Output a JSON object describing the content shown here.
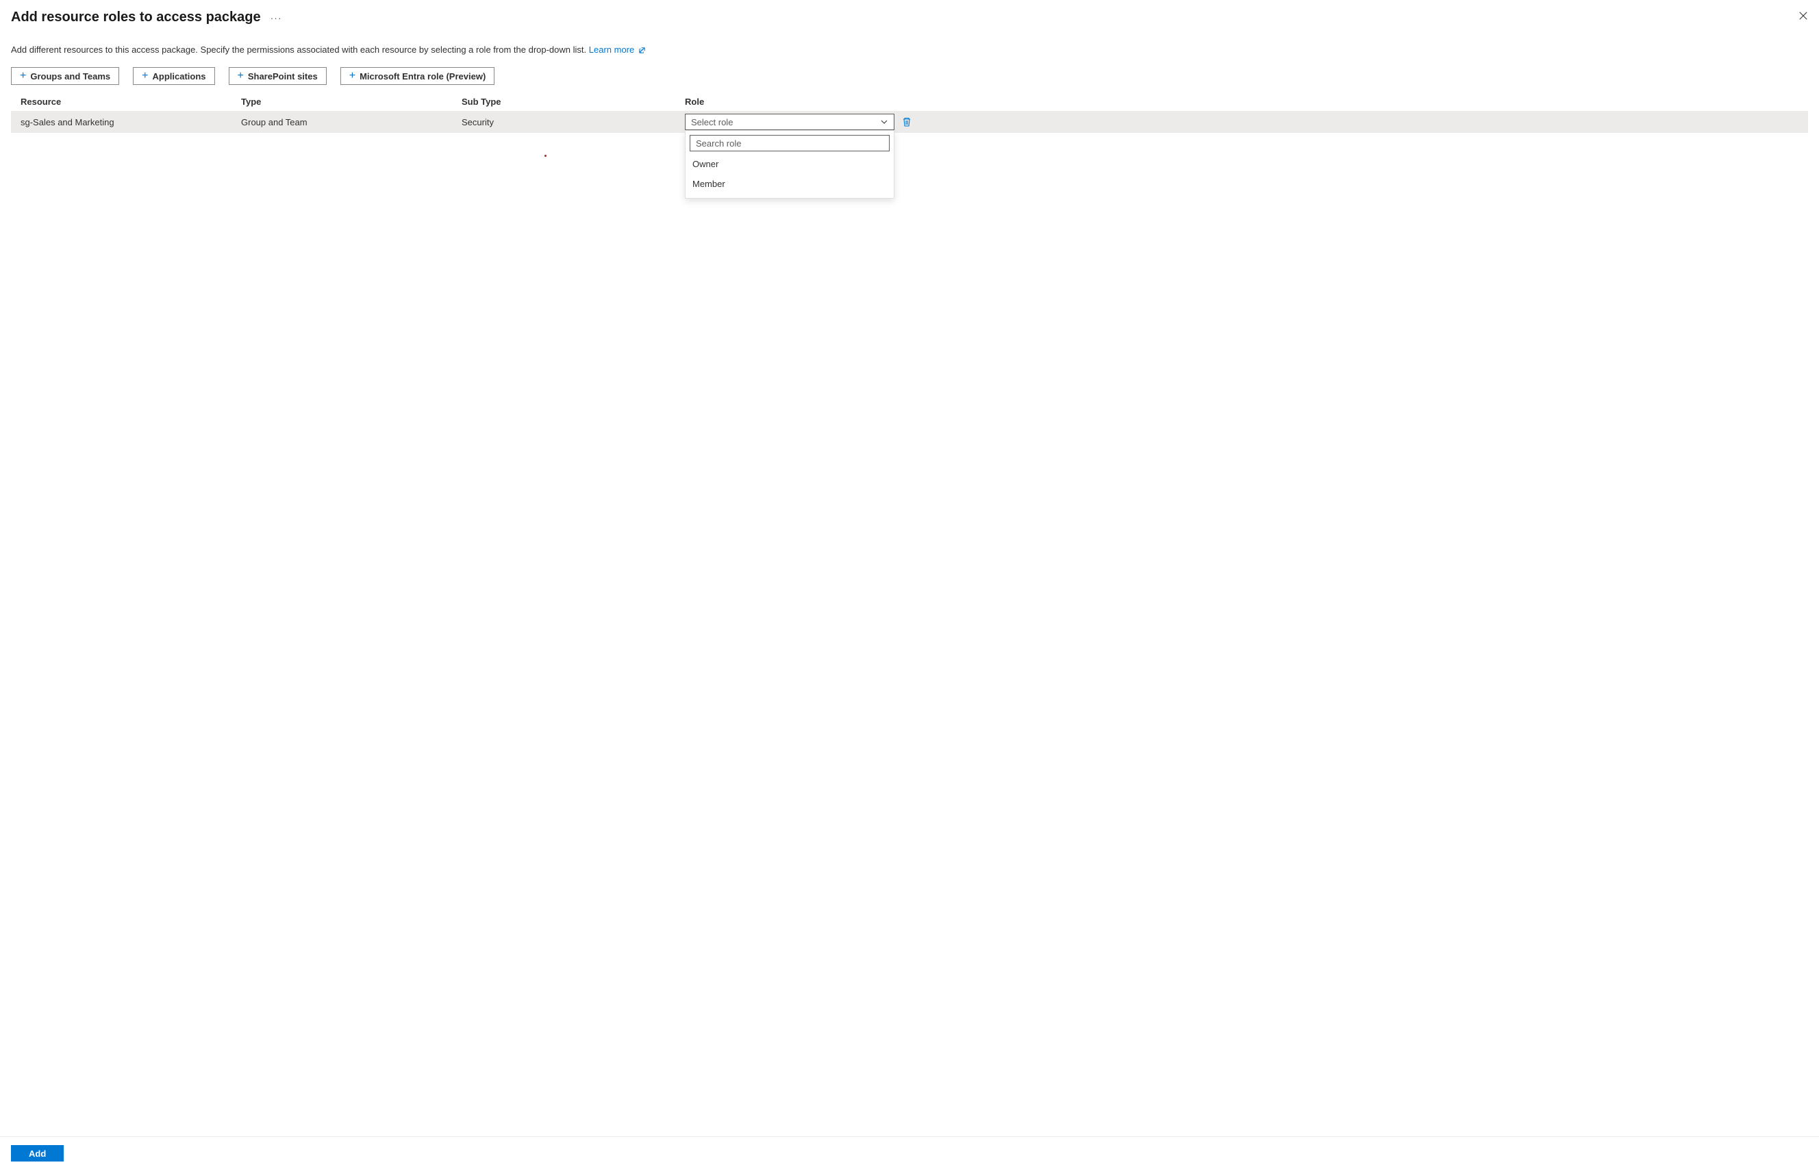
{
  "header": {
    "title": "Add resource roles to access package"
  },
  "description": {
    "text": "Add different resources to this access package. Specify the permissions associated with each resource by selecting a role from the drop-down list. ",
    "learn_more": "Learn more"
  },
  "resource_buttons": {
    "groups": "Groups and Teams",
    "apps": "Applications",
    "sharepoint": "SharePoint sites",
    "entra": "Microsoft Entra role (Preview)"
  },
  "table": {
    "headers": {
      "resource": "Resource",
      "type": "Type",
      "subtype": "Sub Type",
      "role": "Role"
    },
    "rows": [
      {
        "resource": "sg-Sales and Marketing",
        "type": "Group and Team",
        "subtype": "Security"
      }
    ]
  },
  "role_select": {
    "placeholder": "Select role",
    "search_placeholder": "Search role",
    "options": {
      "owner": "Owner",
      "member": "Member"
    }
  },
  "footer": {
    "add": "Add"
  }
}
